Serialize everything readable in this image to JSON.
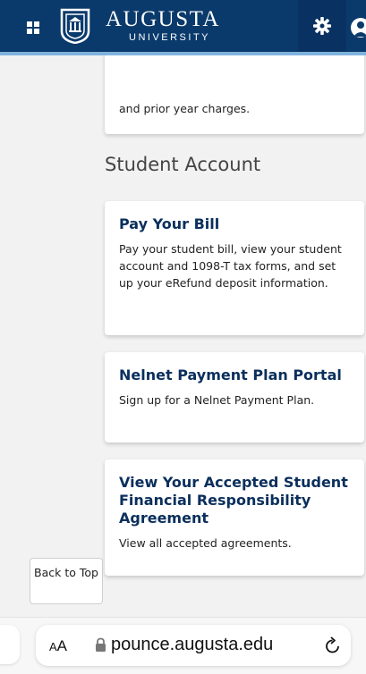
{
  "header": {
    "brand_name": "AUGUSTA",
    "brand_sub": "UNIVERSITY",
    "menu_icon": "grid-menu-icon",
    "settings_icon": "gear-icon",
    "profile_icon": "user-icon",
    "colors": {
      "bar": "#0a3a6b",
      "accent": "#7fb3de"
    }
  },
  "content": {
    "partial_card_text": "and prior year charges.",
    "section_title": "Student Account",
    "cards": [
      {
        "title": "Pay Your Bill",
        "description": "Pay your student bill, view your student account and 1098-T tax forms, and set up your eRefund deposit information."
      },
      {
        "title": "Nelnet Payment Plan Portal",
        "description": "Sign up for a Nelnet Payment Plan."
      },
      {
        "title": "View Your Accepted Student Financial Responsibility Agreement",
        "description": "View all accepted agreements."
      }
    ],
    "back_to_top": "Back to Top"
  },
  "browser": {
    "aa_small": "A",
    "aa_big": "A",
    "url": "pounce.augusta.edu",
    "lock_icon": "lock-icon",
    "reload_icon": "reload-icon"
  }
}
